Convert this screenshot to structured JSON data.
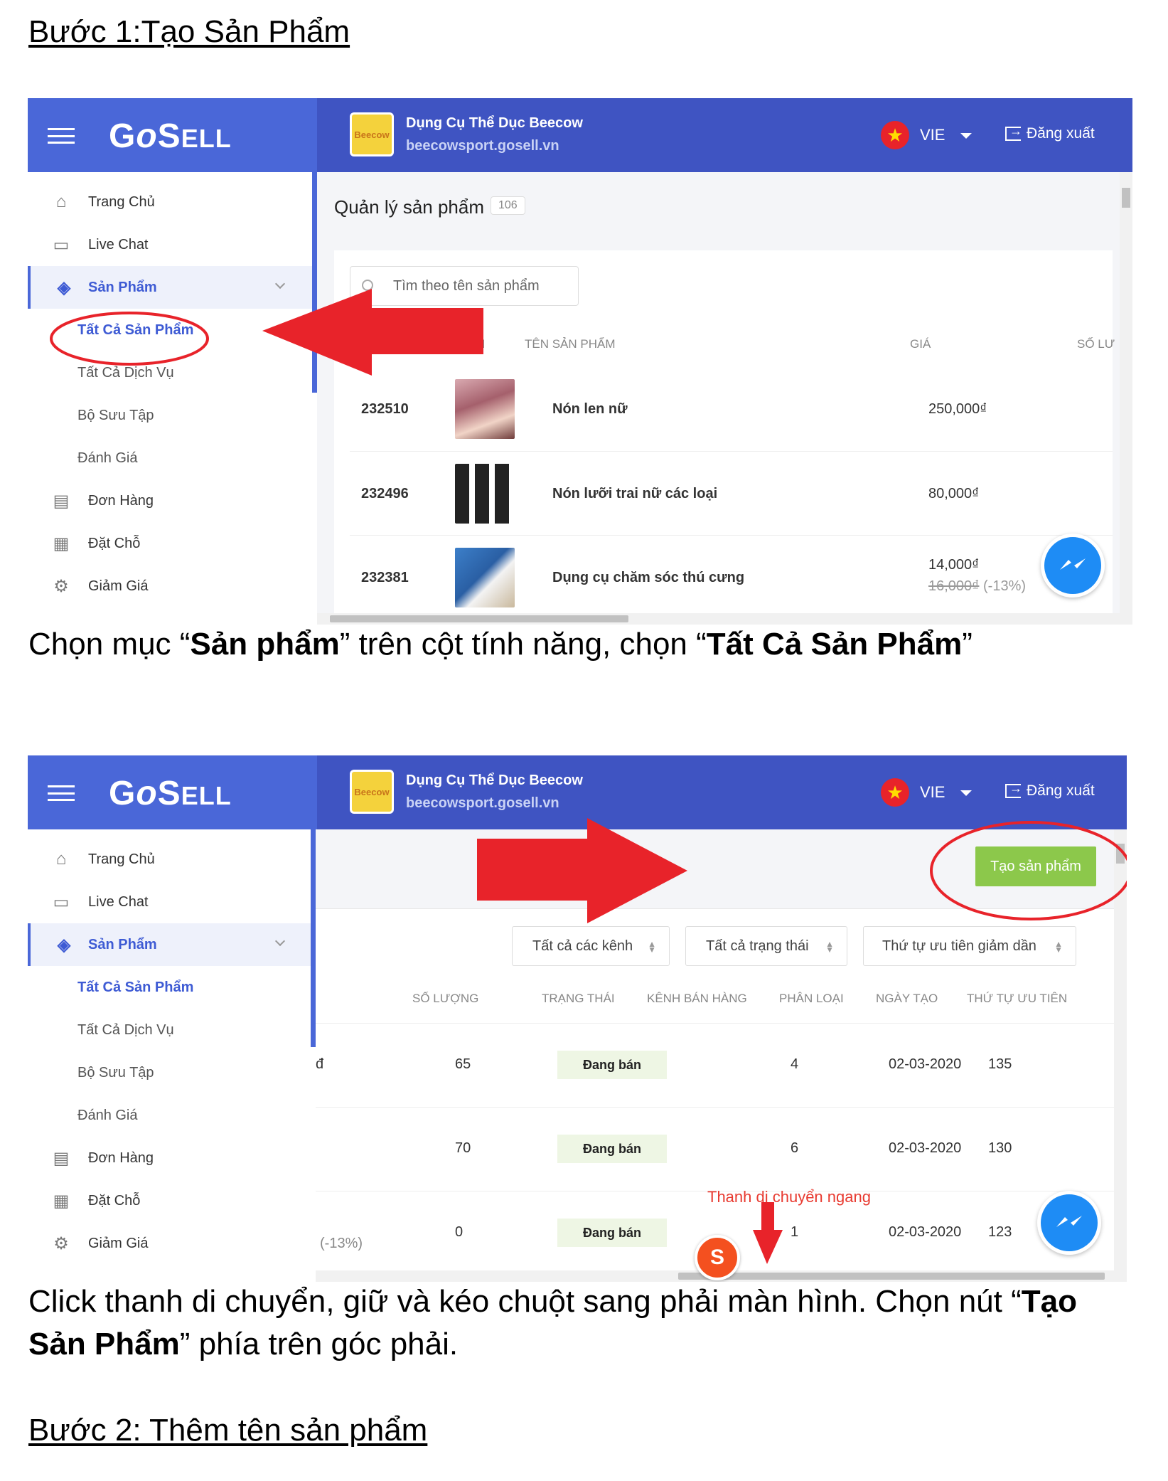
{
  "step1_title": "Bước 1:Tạo Sản Phẩm",
  "step1_caption": {
    "t1": "Chọn mục “",
    "b1": "Sản phẩm",
    "t2": "” trên cột tính năng, chọn “",
    "b2": "Tất Cả Sản Phẩm",
    "t3": "”"
  },
  "step1b_caption": {
    "t1": "Click thanh di chuyển, giữ và kéo chuột sang phải màn hình. Chọn nút “",
    "b1": "Tạo Sản Phẩm",
    "t2": "” phía trên góc phải."
  },
  "step2_title": "Bước 2: Thêm tên sản phẩm",
  "colors": {
    "header_left": "#4a67d8",
    "header_right": "#3f54c2",
    "create_button": "#8cc84b",
    "annotation_red": "#e8232a",
    "messenger": "#1e8cf5"
  },
  "header": {
    "logo": "GoSELL",
    "store_name": "Dụng Cụ Thể Dục Beecow",
    "store_url": "beecowsport.gosell.vn",
    "store_icon_text": "Beecow",
    "language": "VIE",
    "logout": "Đăng xuất"
  },
  "sidebar": {
    "items": [
      {
        "label": "Trang Chủ",
        "icon": "home-icon"
      },
      {
        "label": "Live Chat",
        "icon": "chat-icon"
      },
      {
        "label": "Sản Phẩm",
        "icon": "tag-icon"
      },
      {
        "label": "Tất Cả Sản Phẩm"
      },
      {
        "label": "Tất Cả Dịch Vụ"
      },
      {
        "label": "Bộ Sưu Tập"
      },
      {
        "label": "Đánh Giá"
      },
      {
        "label": "Đơn Hàng",
        "icon": "receipt-icon"
      },
      {
        "label": "Đặt Chỗ",
        "icon": "calendar-icon"
      },
      {
        "label": "Giảm Giá",
        "icon": "discount-icon"
      }
    ]
  },
  "shot1": {
    "title": "Quản lý sản phẩm",
    "count": "106",
    "search_placeholder": "Tìm theo tên sản phẩm",
    "columns": {
      "id": "N",
      "name": "TÊN SẢN PHẨM",
      "price": "GIÁ",
      "qty": "SỐ LƯ"
    },
    "rows": [
      {
        "id": "232510",
        "name": "Nón len nữ",
        "price": "250,000₫"
      },
      {
        "id": "232496",
        "name": "Nón lưỡi trai nữ các loại",
        "price": "80,000₫"
      },
      {
        "id": "232381",
        "name": "Dụng cụ chăm sóc thú cưng",
        "price": "14,000₫",
        "old_price": "16,000₫",
        "discount": "(-13%)"
      }
    ]
  },
  "shot2": {
    "create_button": "Tạo sản phẩm",
    "filters": [
      "Tất cả các kênh",
      "Tất cả trạng thái",
      "Thứ tự ưu tiên giảm dần"
    ],
    "columns": [
      "SỐ LƯỢNG",
      "TRẠNG THÁI",
      "KÊNH BÁN HÀNG",
      "PHÂN LOẠI",
      "NGÀY TẠO",
      "THỨ TỰ ƯU TIÊN"
    ],
    "rows": [
      {
        "left": "đ",
        "qty": "65",
        "status": "Đang bán",
        "variants": "4",
        "date": "02-03-2020",
        "priority": "135"
      },
      {
        "left": "",
        "qty": "70",
        "status": "Đang bán",
        "variants": "6",
        "date": "02-03-2020",
        "priority": "130"
      },
      {
        "left": "(-13%)",
        "qty": "0",
        "status": "Đang bán",
        "variants": "1",
        "date": "02-03-2020",
        "priority": "123"
      }
    ],
    "annotation": "Thanh di chuyển ngang",
    "shopee_icon": "S"
  }
}
